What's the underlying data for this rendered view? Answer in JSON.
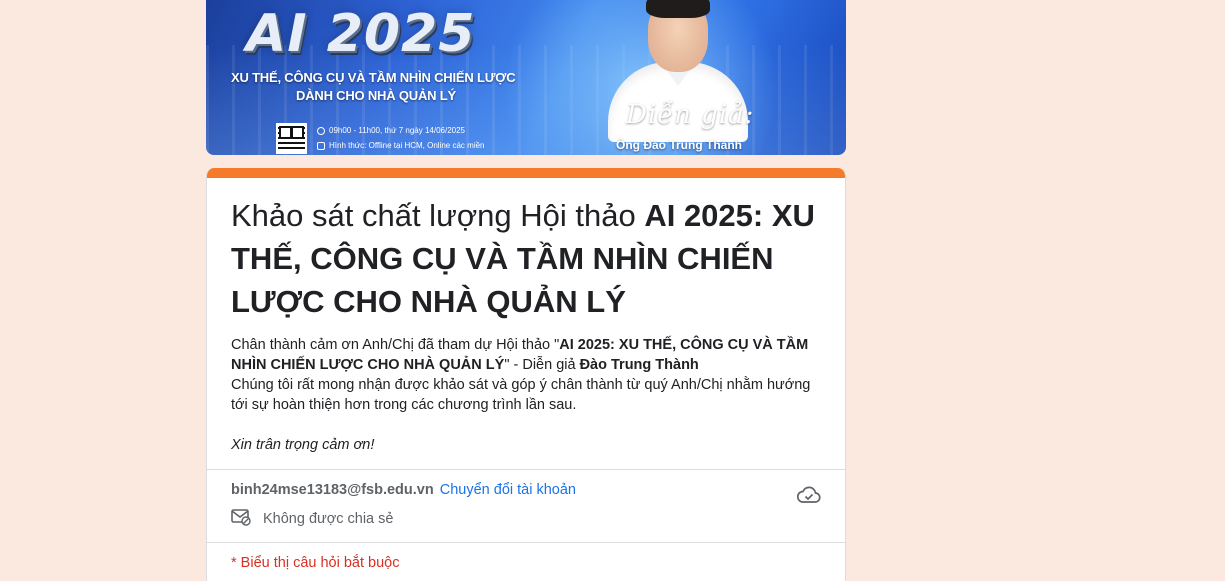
{
  "banner": {
    "title": "AI 2025",
    "subtitle_line1": "XU THẾ, CÔNG CỤ VÀ TẦM NHÌN CHIẾN LƯỢC",
    "subtitle_line2": "DÀNH CHO NHÀ QUẢN LÝ",
    "time_info": "09h00 - 11h00, thứ 7 ngày 14/06/2025",
    "format_info": "Hình thức: Offline tại HCM, Online các miền",
    "speaker_caption": "Diễn giả:",
    "speaker_name": "Ông Đào Trung Thành"
  },
  "form": {
    "title_prefix": "Khảo sát chất lượng Hội thảo ",
    "title_bold": "AI 2025: XU THẾ, CÔNG CỤ VÀ TẦM NHÌN CHIẾN LƯỢC CHO NHÀ QUẢN LÝ",
    "desc_intro": "Chân thành cảm ơn Anh/Chị đã tham dự Hội thảo \"",
    "desc_event": "AI 2025: XU THẾ, CÔNG CỤ VÀ TẦM NHÌN CHIẾN LƯỢC CHO NHÀ QUẢN LÝ",
    "desc_mid": "\" - Diễn giả ",
    "desc_speaker": "Đào Trung Thành",
    "desc_body": "Chúng tôi rất mong nhận được khảo sát và góp ý chân thành từ quý Anh/Chị nhằm hướng tới sự hoàn thiện hơn trong các chương trình lần sau.",
    "desc_thanks": "Xin trân trọng cảm ơn!"
  },
  "account": {
    "email": "binh24mse13183@fsb.edu.vn",
    "switch_label": "Chuyển đổi tài khoản",
    "share_status": "Không được chia sẻ"
  },
  "required_note": "* Biểu thị câu hỏi bắt buộc",
  "colors": {
    "page_bg": "#fbe9df",
    "accent": "#f57a2a",
    "link": "#1a73e8",
    "required": "#d93025"
  }
}
